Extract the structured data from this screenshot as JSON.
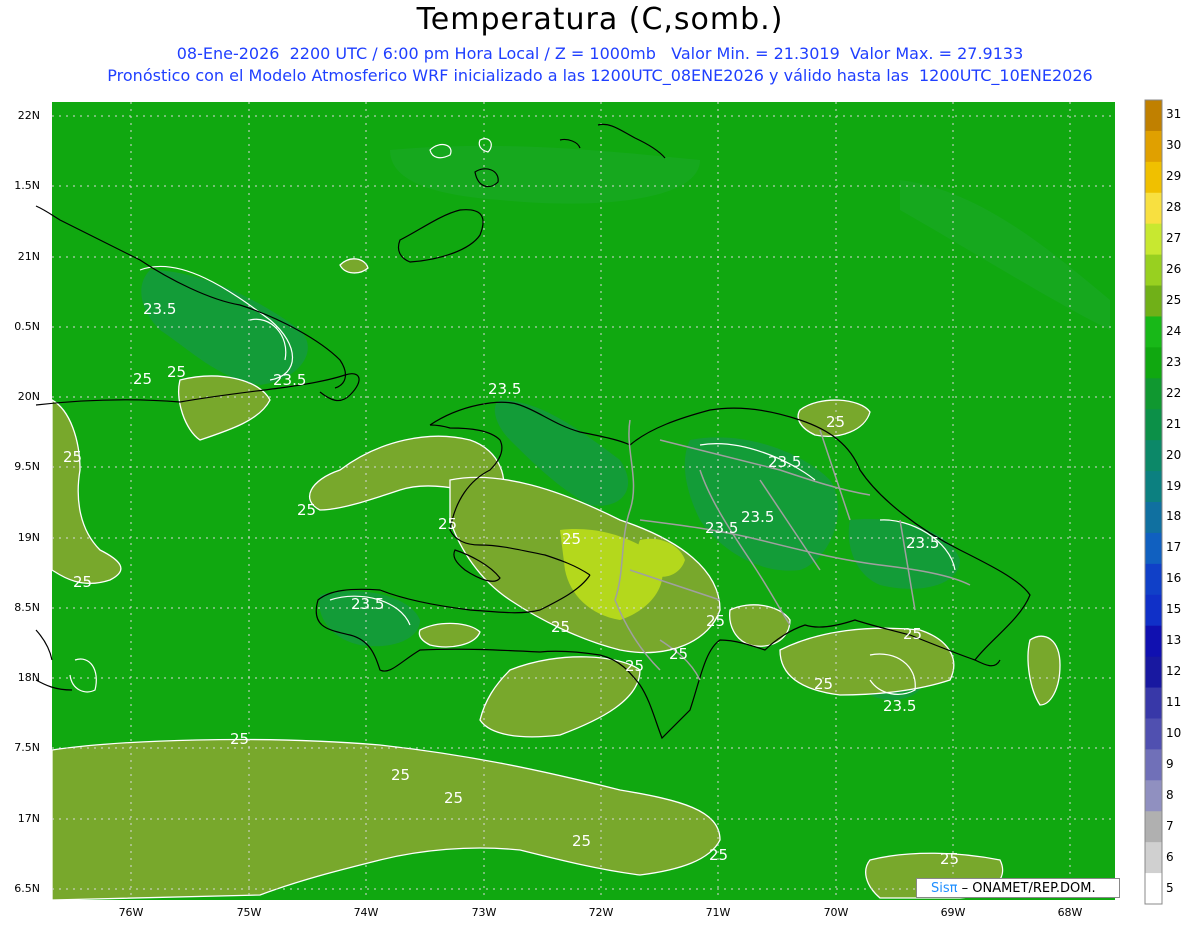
{
  "header": {
    "title": "Temperatura (C,somb.)",
    "line1": "08-Ene-2026  2200 UTC / 6:00 pm Hora Local / Z = 1000mb   Valor Min. = 21.3019  Valor Max. = 27.9133",
    "line2": "Pronóstico con el Modelo Atmosferico WRF inicializado a las 1200UTC_08ENE2026 y válido hasta las  1200UTC_10ENE2026"
  },
  "axes": {
    "lat_labels": [
      "22N",
      "1.5N",
      "21N",
      "0.5N",
      "20N",
      "9.5N",
      "19N",
      "8.5N",
      "18N",
      "7.5N",
      "17N",
      "6.5N"
    ],
    "lon_labels": [
      "76W",
      "75W",
      "74W",
      "73W",
      "72W",
      "71W",
      "70W",
      "69W",
      "68W"
    ]
  },
  "colorbar": {
    "labels": [
      "31",
      "30",
      "29",
      "28",
      "27",
      "26",
      "25",
      "24",
      "23",
      "22",
      "21",
      "20",
      "19",
      "18",
      "17",
      "16",
      "15",
      "13",
      "12",
      "11",
      "10",
      "9",
      "8",
      "7",
      "6",
      "5"
    ],
    "colors": [
      "#c08000",
      "#e0a000",
      "#f0c000",
      "#f8e040",
      "#c8e830",
      "#98d020",
      "#70b018",
      "#18b818",
      "#10a810",
      "#109830",
      "#0c9048",
      "#0c8868",
      "#0c8080",
      "#1070a0",
      "#1060c0",
      "#1040c8",
      "#1030c8",
      "#1010b0",
      "#1818a0",
      "#3838a8",
      "#5050b0",
      "#7070b8",
      "#9090c0",
      "#b0b0b0",
      "#d0d0d0",
      "#ffffff"
    ]
  },
  "contour_labels": [
    "23.5",
    "25",
    "25",
    "23.5",
    "23.5",
    "25",
    "25",
    "25",
    "25",
    "23.5",
    "23.5",
    "23.5",
    "25",
    "23.5",
    "23.5",
    "25",
    "25",
    "25",
    "25",
    "25",
    "25",
    "23.5",
    "25",
    "25",
    "25",
    "25",
    "25",
    "25"
  ],
  "credit": {
    "logo": "Sisπ",
    "text": "– ONAMET/REP.DOM."
  },
  "colors": {
    "base_green": "#10a810",
    "warm_olive": "#78a82c",
    "cool_green": "#149a40",
    "hot_yellow": "#b4d81c",
    "contour": "#ffffff",
    "coast": "#000000",
    "border": "#a0a0a0"
  }
}
